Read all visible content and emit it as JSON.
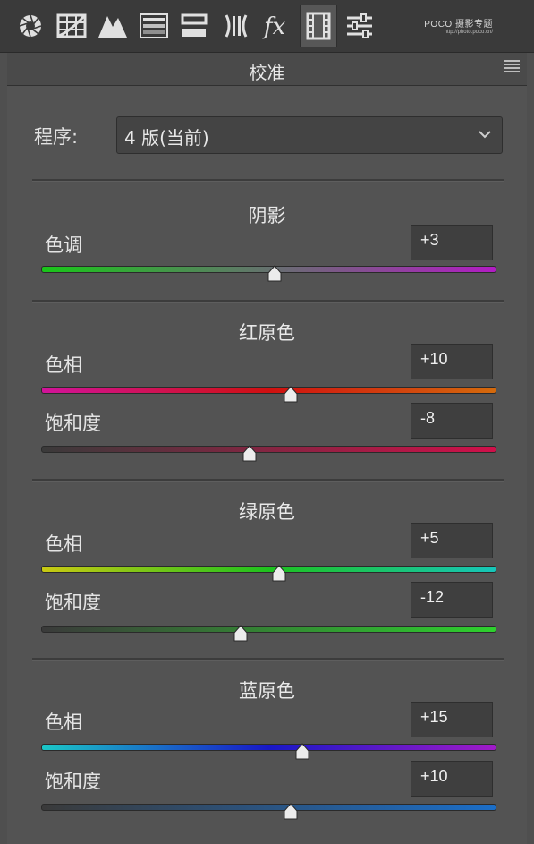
{
  "toolbar": {
    "icons": [
      "basic-aperture-icon",
      "tone-curve-grid-icon",
      "detail-mountains-icon",
      "hsl-bars-icon",
      "split-toning-icon",
      "lens-corrections-icon",
      "fx-effects-icon",
      "camera-calibration-film-icon",
      "presets-sliders-icon"
    ],
    "watermark_brand": "POCO 摄影专题",
    "watermark_url": "http://photo.poco.cn/"
  },
  "panel": {
    "title": "校准"
  },
  "process": {
    "label": "程序:",
    "value": "4 版(当前)"
  },
  "sections": [
    {
      "title": "阴影",
      "controls": [
        {
          "label": "色调",
          "value": "+3",
          "position": 0.515
        }
      ]
    },
    {
      "title": "红原色",
      "controls": [
        {
          "label": "色相",
          "value": "+10",
          "position": 0.55
        },
        {
          "label": "饱和度",
          "value": "-8",
          "position": 0.46
        }
      ]
    },
    {
      "title": "绿原色",
      "controls": [
        {
          "label": "色相",
          "value": "+5",
          "position": 0.525
        },
        {
          "label": "饱和度",
          "value": "-12",
          "position": 0.44
        }
      ]
    },
    {
      "title": "蓝原色",
      "controls": [
        {
          "label": "色相",
          "value": "+15",
          "position": 0.575
        },
        {
          "label": "饱和度",
          "value": "+10",
          "position": 0.55
        }
      ]
    }
  ],
  "colors": {
    "shadow_tint": [
      "#19c619",
      "#b21cc4"
    ],
    "red_hue": [
      "#d1139a",
      "#d01010",
      "#d46a0c"
    ],
    "red_sat": [
      "#3a3a3a",
      "#d0104a"
    ],
    "green_hue": [
      "#c9c912",
      "#1ec21e",
      "#16c6ba"
    ],
    "green_sat": [
      "#3a3a3a",
      "#2ed12e"
    ],
    "blue_hue": [
      "#1ac7c7",
      "#1818c8",
      "#a01ac8"
    ],
    "blue_sat": [
      "#3a3a3a",
      "#1b6ec8"
    ]
  }
}
